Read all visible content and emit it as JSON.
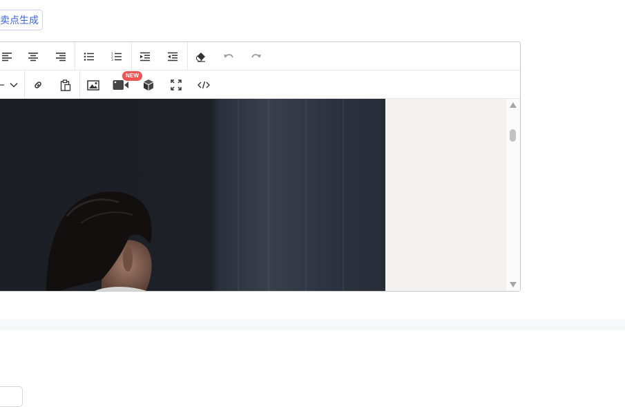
{
  "generate_button": {
    "label": "卖点生成"
  },
  "editor": {
    "toolbar_row1": [
      "align-left-icon",
      "align-center-icon",
      "align-right-icon",
      "bullet-list-icon",
      "numbered-list-icon",
      "indent-icon",
      "outdent-icon",
      "eraser-icon",
      "undo-icon",
      "redo-icon"
    ],
    "toolbar_row2": [
      "chevron-down-icon",
      "link-icon",
      "paste-icon",
      "image-icon",
      "video-icon",
      "box-3d-icon",
      "fullscreen-icon",
      "code-icon"
    ],
    "video_badge": "NEW"
  },
  "colors": {
    "accent": "#3a63d6",
    "badge": "#f05555"
  }
}
